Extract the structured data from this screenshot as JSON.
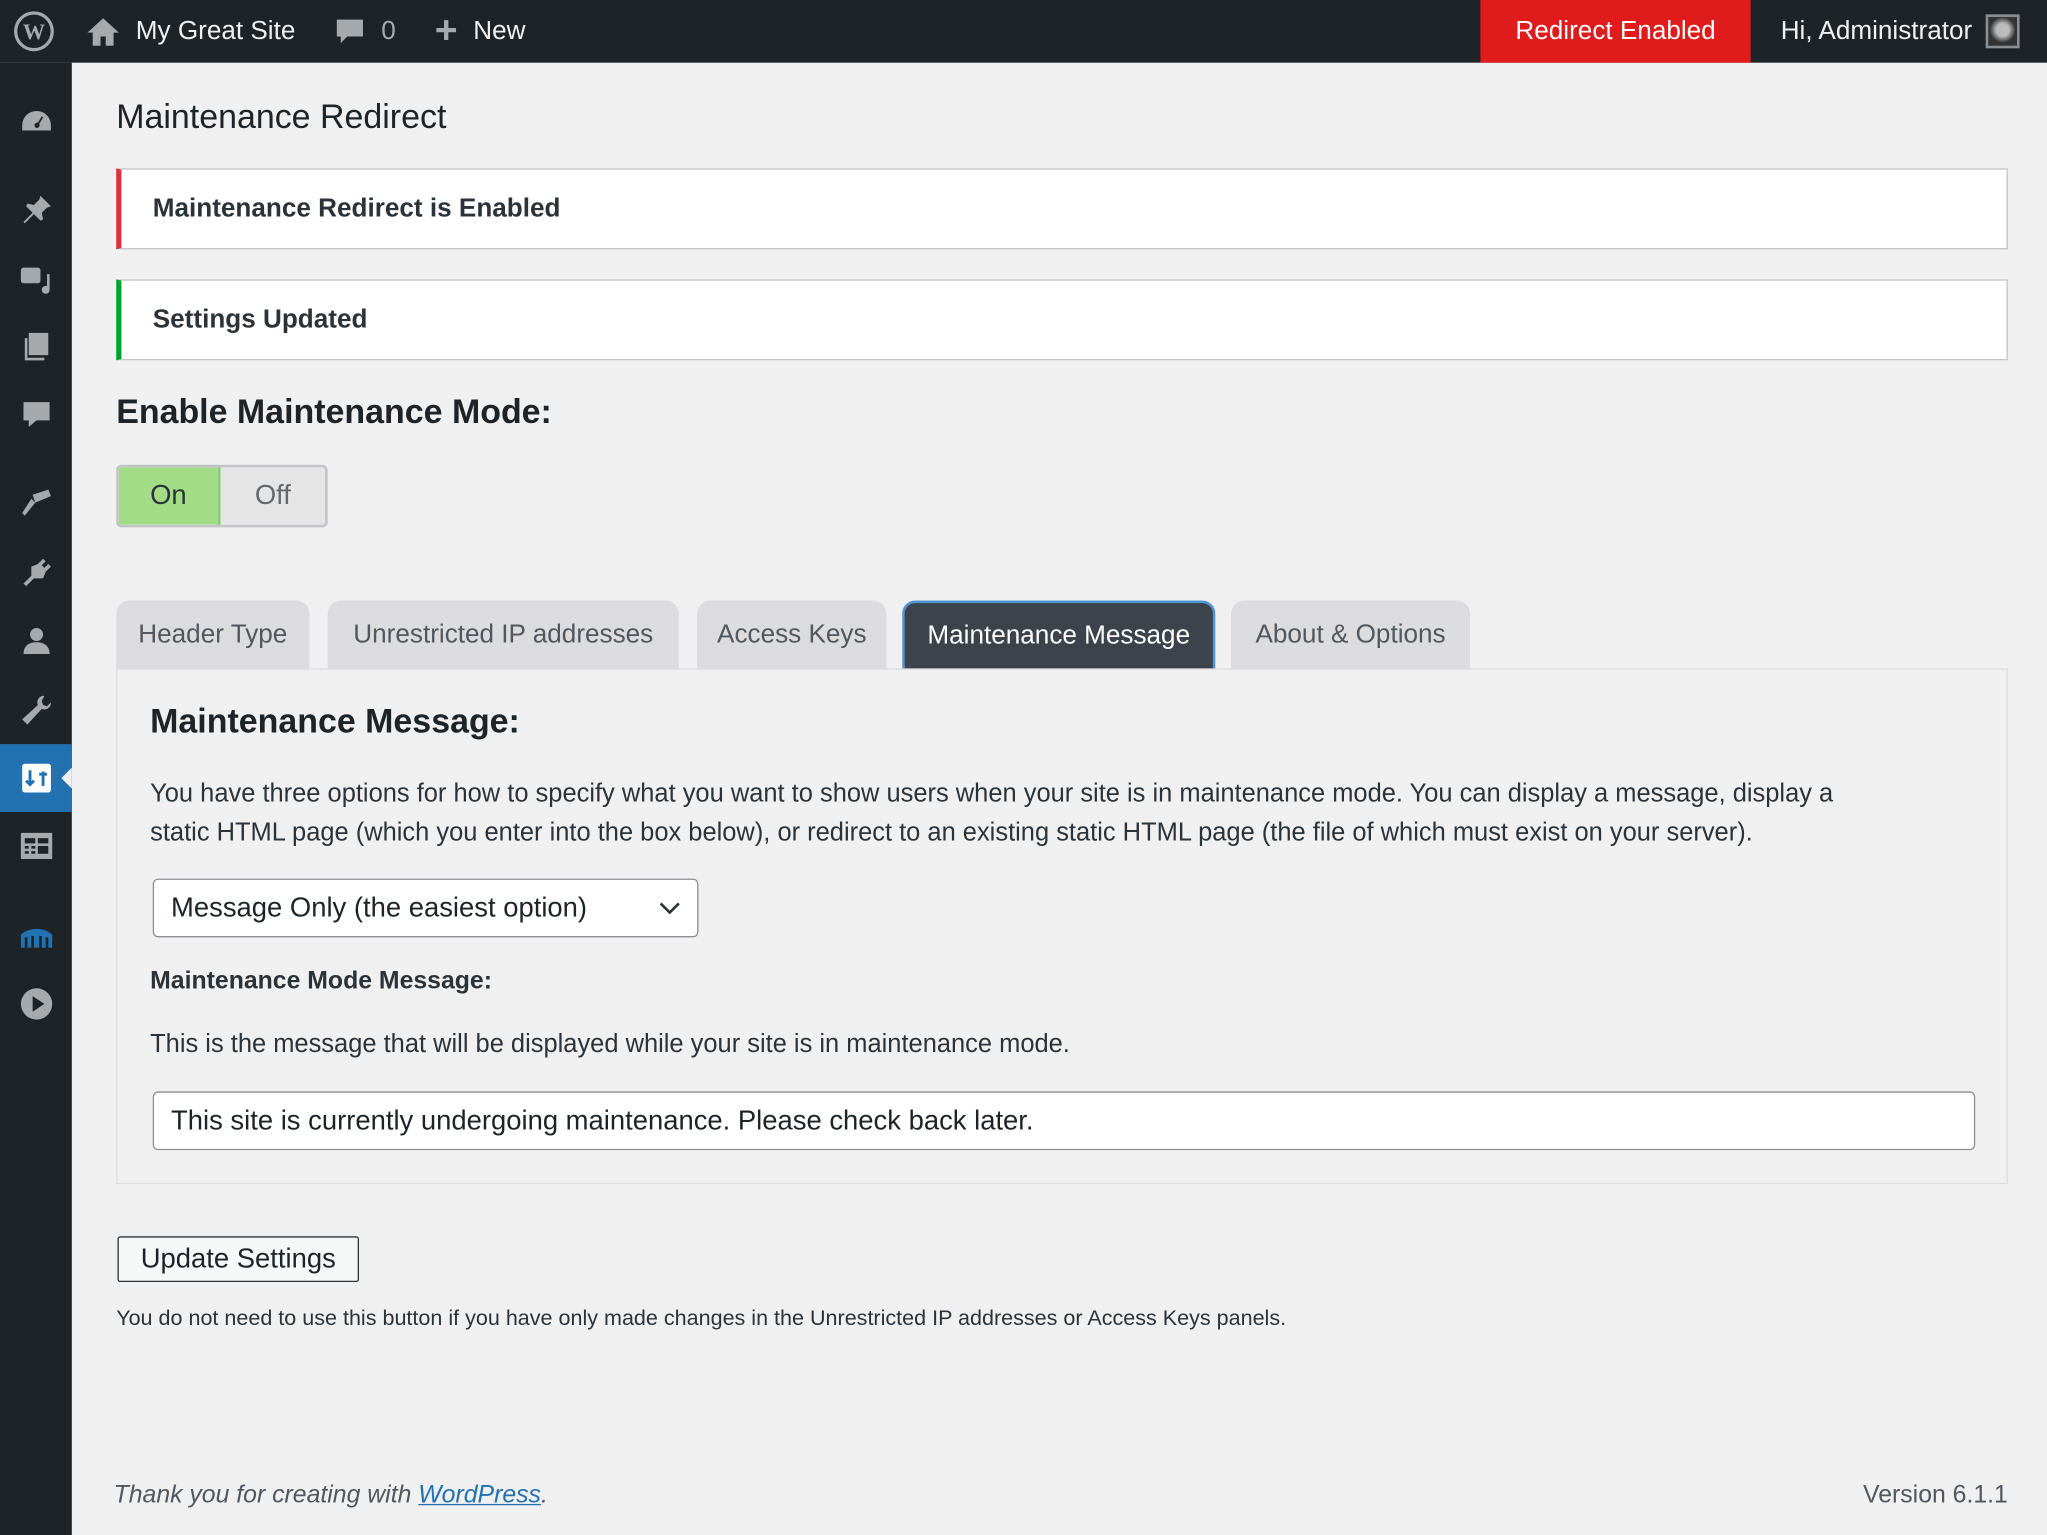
{
  "adminbar": {
    "site_name": "My Great Site",
    "comments_count": "0",
    "new_label": "New",
    "redirect_badge": "Redirect Enabled",
    "greeting": "Hi, Administrator",
    "badge_color": "#e01b1b"
  },
  "sidebar": {
    "items": [
      "dashboard-icon",
      "posts-icon",
      "media-icon",
      "pages-icon",
      "comments-icon",
      "appearance-icon",
      "plugins-icon",
      "users-icon",
      "tools-icon",
      "maintenance-redirect-icon",
      "forms-icon",
      "bridge-icon",
      "play-icon"
    ],
    "active_index": 9,
    "accent": "#2271b1"
  },
  "page": {
    "title": "Maintenance Redirect",
    "notices": [
      {
        "text": "Maintenance Redirect is Enabled",
        "color": "#d63638"
      },
      {
        "text": "Settings Updated",
        "color": "#00a32a"
      }
    ],
    "enable_heading": "Enable Maintenance Mode:",
    "toggle": {
      "on": "On",
      "off": "Off",
      "selected": "On"
    },
    "tabs": [
      "Header Type",
      "Unrestricted IP addresses",
      "Access Keys",
      "Maintenance Message",
      "About & Options"
    ],
    "active_tab": "Maintenance Message",
    "panel": {
      "heading": "Maintenance Message:",
      "description_line1": "You have three options for how to specify what you want to show users when your site is in maintenance mode. You can display a message, display a",
      "description_line2": "static HTML page (which you enter into the box below), or redirect to an existing static HTML page (the file of which must exist on your server).",
      "select_value": "Message Only (the easiest option)",
      "message_label": "Maintenance Mode Message:",
      "message_help": "This is the message that will be displayed while your site is in maintenance mode.",
      "message_value": "This site is currently undergoing maintenance. Please check back later."
    },
    "update_button": "Update Settings",
    "update_note": "You do not need to use this button if you have only made changes in the Unrestricted IP addresses or Access Keys panels."
  },
  "footer": {
    "thanks": "Thank you for creating with ",
    "link": "WordPress",
    "period": ".",
    "version": "Version 6.1.1"
  }
}
